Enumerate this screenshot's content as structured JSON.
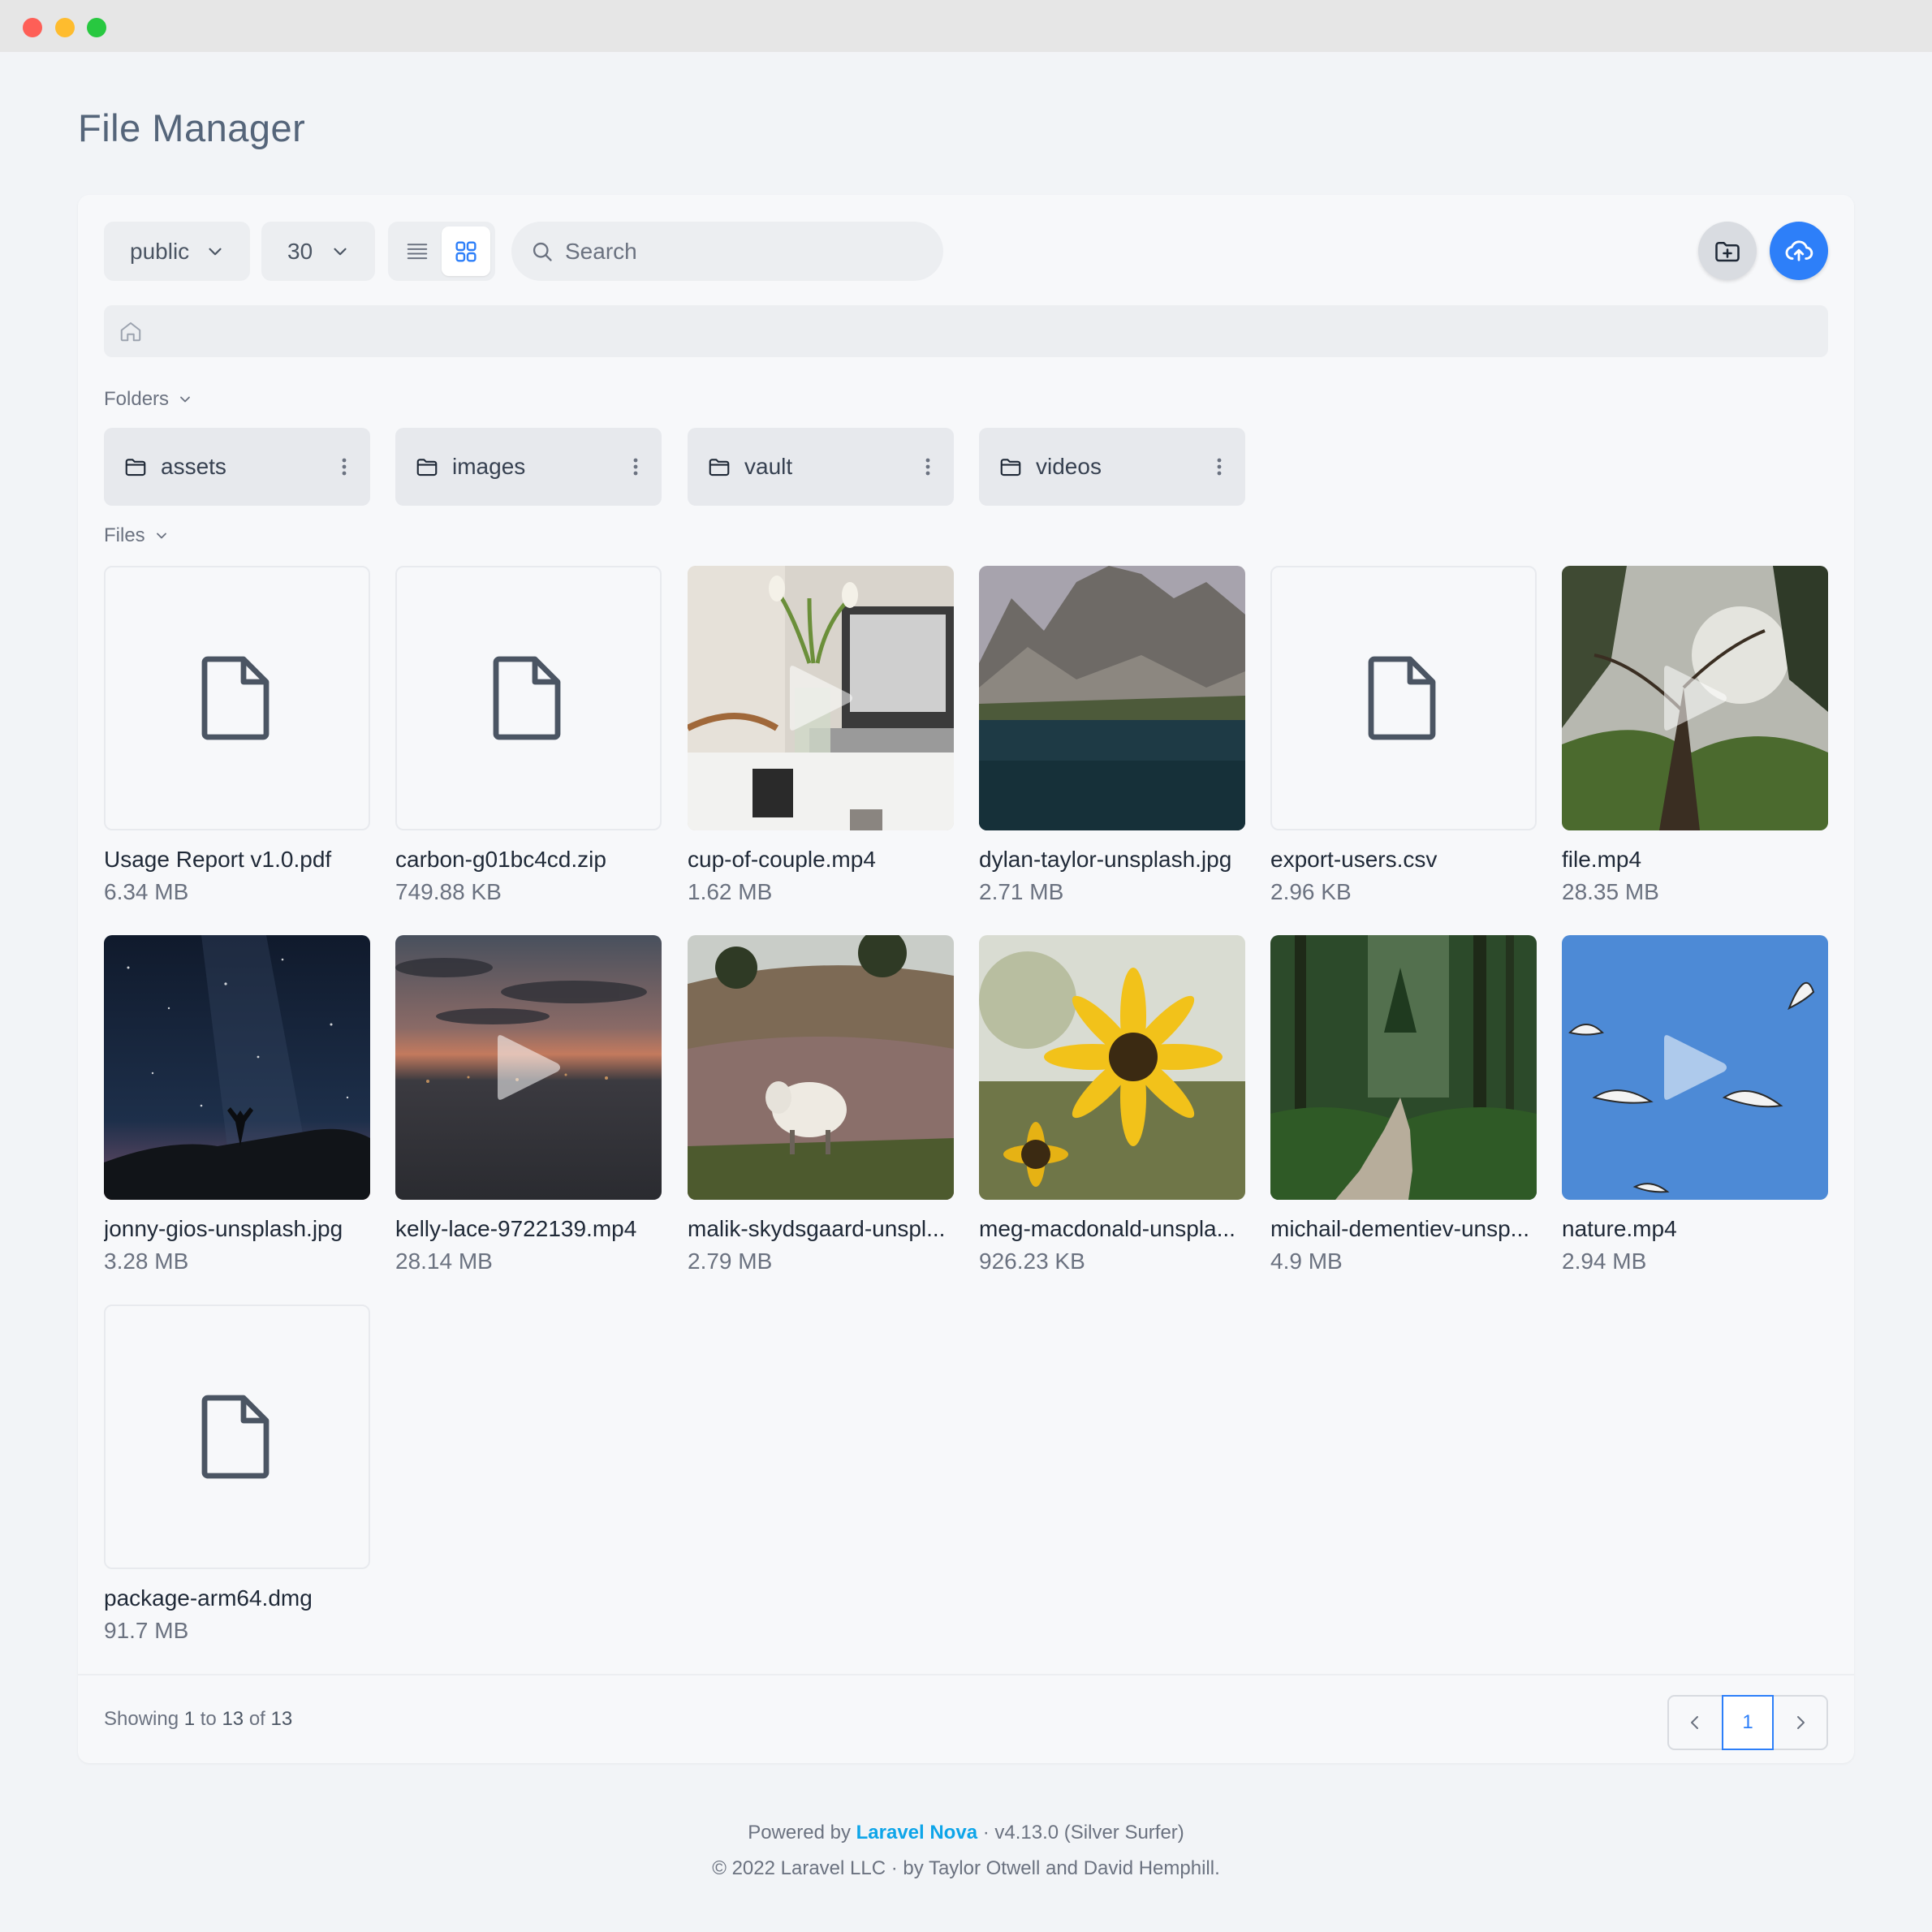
{
  "window": {
    "controls": [
      "close",
      "minimize",
      "maximize"
    ]
  },
  "page_title": "File Manager",
  "toolbar": {
    "disk_select": {
      "value": "public",
      "icon": "chevron-down-icon"
    },
    "per_page_select": {
      "value": "30",
      "icon": "chevron-down-icon"
    },
    "view_modes": [
      "list",
      "grid"
    ],
    "active_view": "grid",
    "search": {
      "placeholder": "Search",
      "value": ""
    },
    "create_folder_icon": "folder-plus-icon",
    "upload_icon": "cloud-upload-icon",
    "accent_color": "#2d7ff9"
  },
  "breadcrumb": {
    "home_icon": "home-icon"
  },
  "folders_section": {
    "label": "Folders",
    "items": [
      {
        "name": "assets"
      },
      {
        "name": "images"
      },
      {
        "name": "vault"
      },
      {
        "name": "videos"
      }
    ]
  },
  "files_section": {
    "label": "Files",
    "items": [
      {
        "name": "Usage Report v1.0.pdf",
        "size": "6.34 MB",
        "kind": "document"
      },
      {
        "name": "carbon-g01bc4cd.zip",
        "size": "749.88 KB",
        "kind": "document"
      },
      {
        "name": "cup-of-couple.mp4",
        "size": "1.62 MB",
        "kind": "video"
      },
      {
        "name": "dylan-taylor-unsplash.jpg",
        "size": "2.71 MB",
        "kind": "image"
      },
      {
        "name": "export-users.csv",
        "size": "2.96 KB",
        "kind": "document"
      },
      {
        "name": "file.mp4",
        "size": "28.35 MB",
        "kind": "video"
      },
      {
        "name": "jonny-gios-unsplash.jpg",
        "size": "3.28 MB",
        "kind": "image"
      },
      {
        "name": "kelly-lace-9722139.mp4",
        "size": "28.14 MB",
        "kind": "video"
      },
      {
        "name": "malik-skydsgaard-unspl...",
        "size": "2.79 MB",
        "kind": "image"
      },
      {
        "name": "meg-macdonald-unspla...",
        "size": "926.23 KB",
        "kind": "image"
      },
      {
        "name": "michail-dementiev-unsp...",
        "size": "4.9 MB",
        "kind": "image"
      },
      {
        "name": "nature.mp4",
        "size": "2.94 MB",
        "kind": "video"
      },
      {
        "name": "package-arm64.dmg",
        "size": "91.7 MB",
        "kind": "document"
      }
    ]
  },
  "pagination": {
    "showing_prefix": "Showing",
    "from": "1",
    "to_word": "to",
    "to": "13",
    "of_word": "of",
    "total": "13",
    "current_page": "1"
  },
  "footer": {
    "powered_by": "Powered by",
    "brand": "Laravel Nova",
    "version": "· v4.13.0 (Silver Surfer)",
    "copyright": "© 2022 Laravel LLC · by Taylor Otwell and David Hemphill."
  }
}
